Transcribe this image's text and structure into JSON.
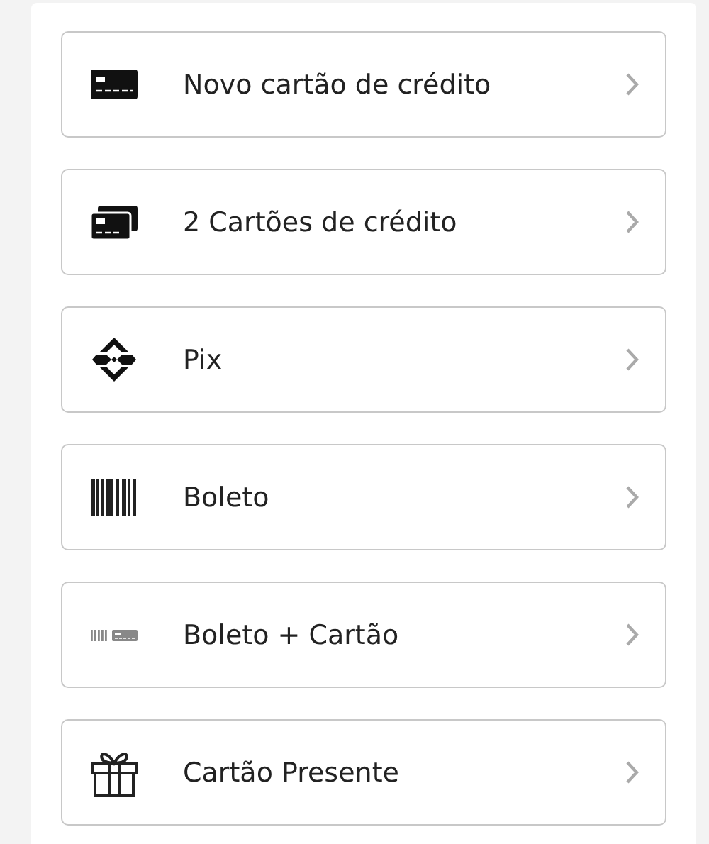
{
  "payment_options": [
    {
      "kind": "card",
      "label": "Novo cartão de crédito"
    },
    {
      "kind": "two-cards",
      "label": "2 Cartões de crédito"
    },
    {
      "kind": "pix",
      "label": "Pix"
    },
    {
      "kind": "barcode",
      "label": "Boleto"
    },
    {
      "kind": "barcode-card",
      "label": "Boleto + Cartão"
    },
    {
      "kind": "gift",
      "label": "Cartão Presente"
    }
  ]
}
